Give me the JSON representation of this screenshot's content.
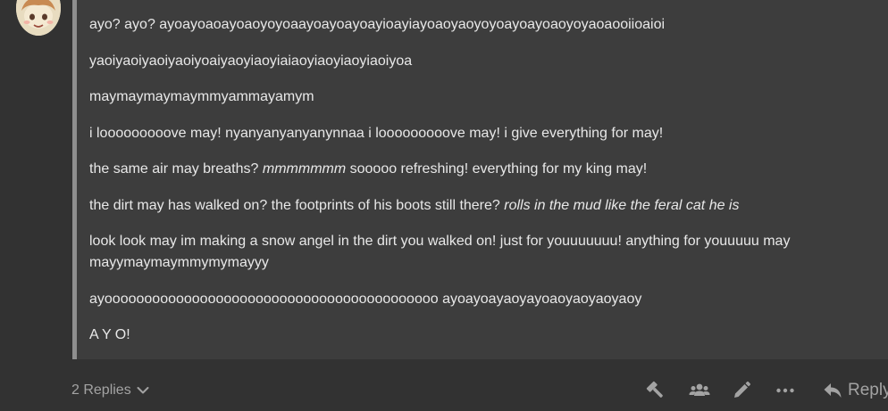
{
  "post": {
    "paragraphs": [
      {
        "parts": [
          {
            "t": "ayo? ayo? ayoayoaoayoaoyoyoaayoayoayoayioayiayoaoyaoyoyoayoayoaoyoyaoaooiioaioi",
            "em": false
          }
        ]
      },
      {
        "parts": [
          {
            "t": "yaoiyaoiyaoiyaoiyoaiyaoyiaoyiaiaoyiaoyiaoyiaoiyoa",
            "em": false
          }
        ]
      },
      {
        "parts": [
          {
            "t": "maymaymaymaymmyammayamym",
            "em": false
          }
        ]
      },
      {
        "parts": [
          {
            "t": "i looooooooove may! nyanyanyanyanynnaa i looooooooove may! i give everything for may!",
            "em": false
          }
        ]
      },
      {
        "parts": [
          {
            "t": "the same air may breaths? ",
            "em": false
          },
          {
            "t": "mmmmmmm",
            "em": true
          },
          {
            "t": " sooooo refreshing! everything for my king may!",
            "em": false
          }
        ]
      },
      {
        "parts": [
          {
            "t": "the dirt may has walked on? the footprints of his boots still there? ",
            "em": false
          },
          {
            "t": "rolls in the mud like the feral cat he is",
            "em": true
          }
        ]
      },
      {
        "parts": [
          {
            "t": "look look may im making a snow angel in the dirt you walked on! just for youuuuuuu! anything for youuuuu may mayymaymaymmymymayyy",
            "em": false
          }
        ]
      },
      {
        "parts": [
          {
            "t": "ayoooooooooooooooooooooooooooooooooooooooooo ayoayoayaoyayoaoyaoyaoyaoy",
            "em": false
          }
        ]
      },
      {
        "parts": [
          {
            "t": "A Y O!",
            "em": false
          }
        ]
      }
    ]
  },
  "footer": {
    "replies_label": "2 Replies",
    "reply_label": "Reply",
    "icons": [
      "hammer-icon",
      "group-icon",
      "pencil-icon",
      "more-icon",
      "reply-arrow-icon",
      "chevron-down-icon"
    ],
    "icon_color": "#a3a3a3"
  },
  "colors": {
    "background": "#323232",
    "quote_background": "#3d3d3d",
    "quote_border": "#8f8f8f",
    "text": "#e8e8e8",
    "muted": "#a3a3a3"
  }
}
